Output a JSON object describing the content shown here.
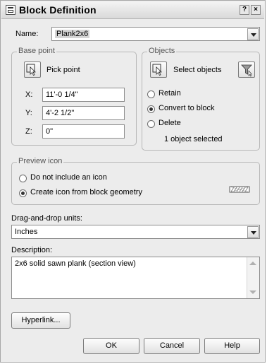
{
  "titlebar": {
    "title": "Block Definition",
    "help_glyph": "?",
    "close_glyph": "×"
  },
  "name": {
    "label": "Name:",
    "value": "Plank2x6"
  },
  "base_point": {
    "group_title": "Base point",
    "pick_label": "Pick point",
    "x_label": "X:",
    "x_value": "11'-0 1/4\"",
    "y_label": "Y:",
    "y_value": "4'-2 1/2\"",
    "z_label": "Z:",
    "z_value": "0\""
  },
  "objects": {
    "group_title": "Objects",
    "select_label": "Select objects",
    "retain_label": "Retain",
    "convert_label": "Convert to block",
    "delete_label": "Delete",
    "status_text": "1 object selected",
    "selected_option": "convert"
  },
  "preview": {
    "group_title": "Preview icon",
    "no_icon_label": "Do not include an icon",
    "create_icon_label": "Create icon from block geometry",
    "selected_option": "create"
  },
  "units": {
    "label": "Drag-and-drop units:",
    "value": "Inches"
  },
  "description": {
    "label": "Description:",
    "value": "2x6 solid sawn plank (section view)"
  },
  "buttons": {
    "hyperlink": "Hyperlink...",
    "ok": "OK",
    "cancel": "Cancel",
    "help": "Help"
  },
  "icons": [
    "block-definition-icon",
    "help-icon",
    "close-icon",
    "pick-point-icon",
    "select-objects-icon",
    "quick-select-icon",
    "chevron-down-icon",
    "block-preview-icon"
  ]
}
